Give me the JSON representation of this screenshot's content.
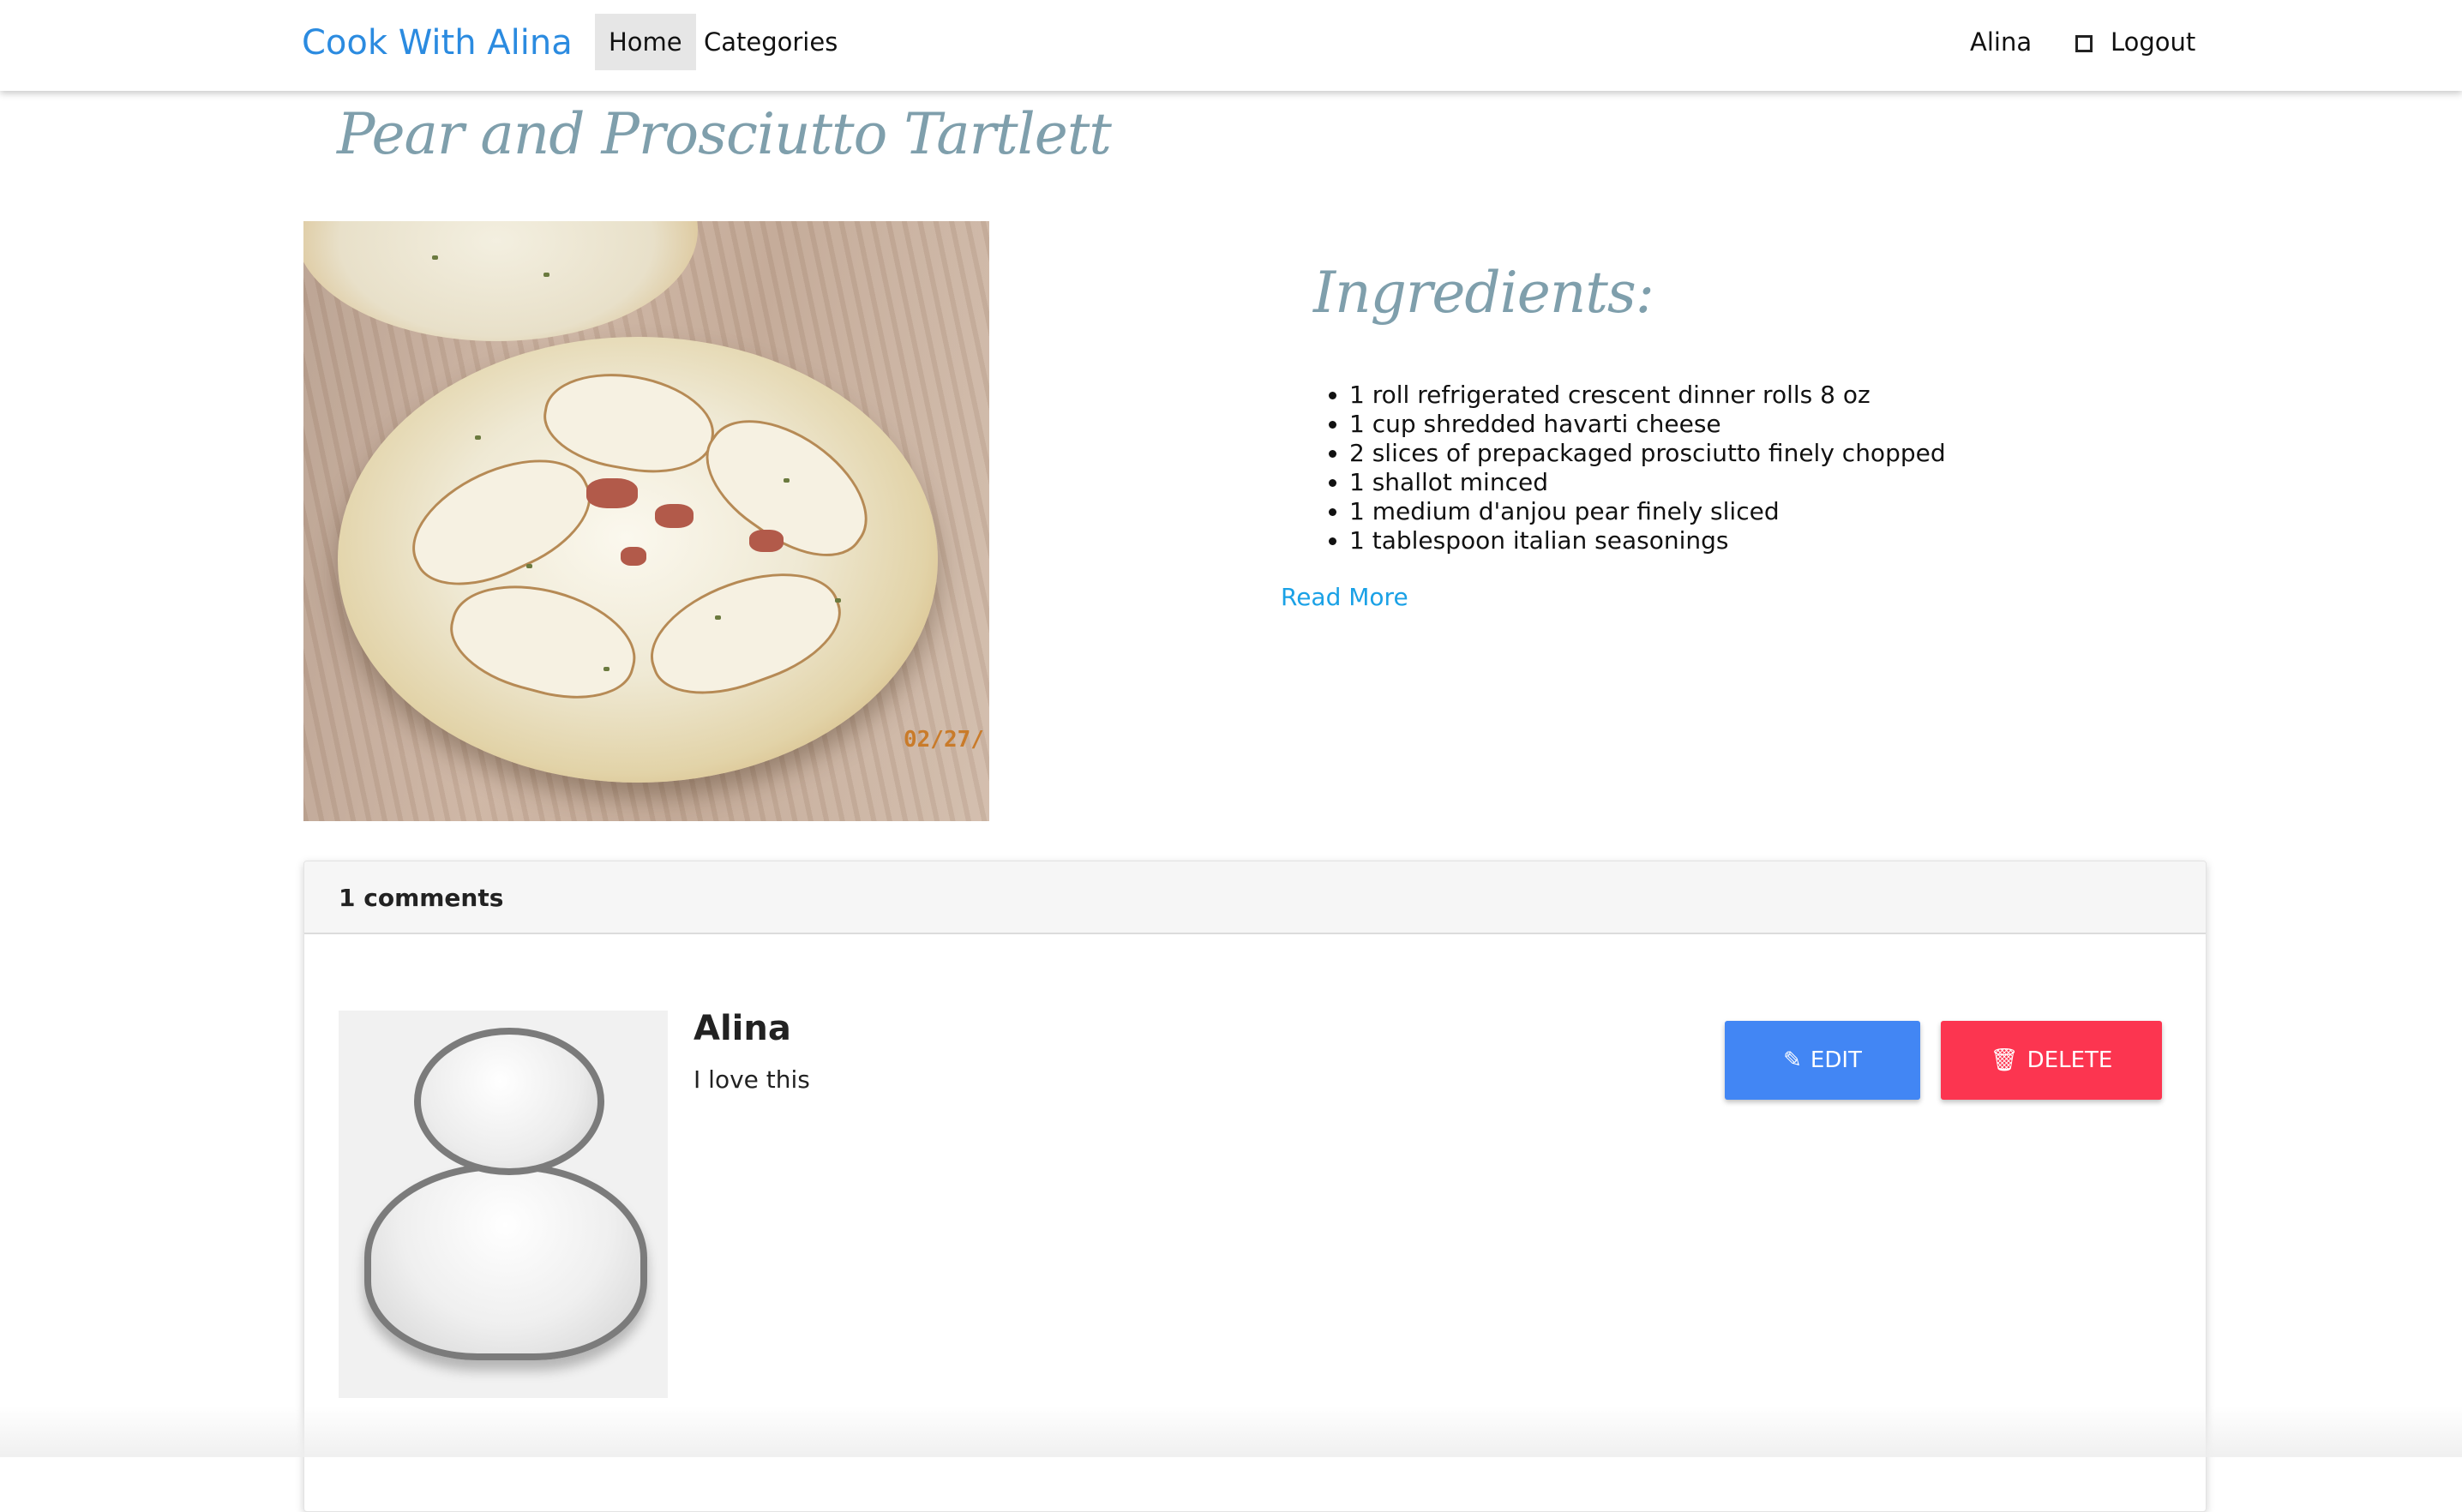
{
  "navbar": {
    "brand": "Cook With Alina",
    "items": [
      {
        "label": "Home",
        "active": true
      },
      {
        "label": "Categories",
        "active": false
      }
    ],
    "user": "Alina",
    "logout_label": "Logout"
  },
  "recipe": {
    "title": "Pear and Prosciutto Tartlett",
    "photo_stamp": "02/27/",
    "ingredients_title": "Ingredients:",
    "ingredients": [
      "1 roll refrigerated crescent dinner rolls 8 oz",
      "1 cup shredded havarti cheese",
      "2 slices of prepackaged prosciutto finely chopped",
      "1 shallot minced",
      "1 medium d'anjou pear finely sliced",
      "1 tablespoon italian seasonings"
    ],
    "read_more_label": "Read More"
  },
  "comments": {
    "count_label": "1 comments",
    "items": [
      {
        "author": "Alina",
        "text": "I love this",
        "edit_label": "EDIT",
        "delete_label": "DELETE"
      }
    ]
  },
  "colors": {
    "brand": "#2b8be0",
    "heading": "#7f9fac",
    "link": "#1aa1e6",
    "edit_button": "#4286f4",
    "delete_button": "#fc3550"
  },
  "icons": {
    "logout": "square-icon",
    "edit": "edit-icon",
    "delete": "trash-icon"
  }
}
